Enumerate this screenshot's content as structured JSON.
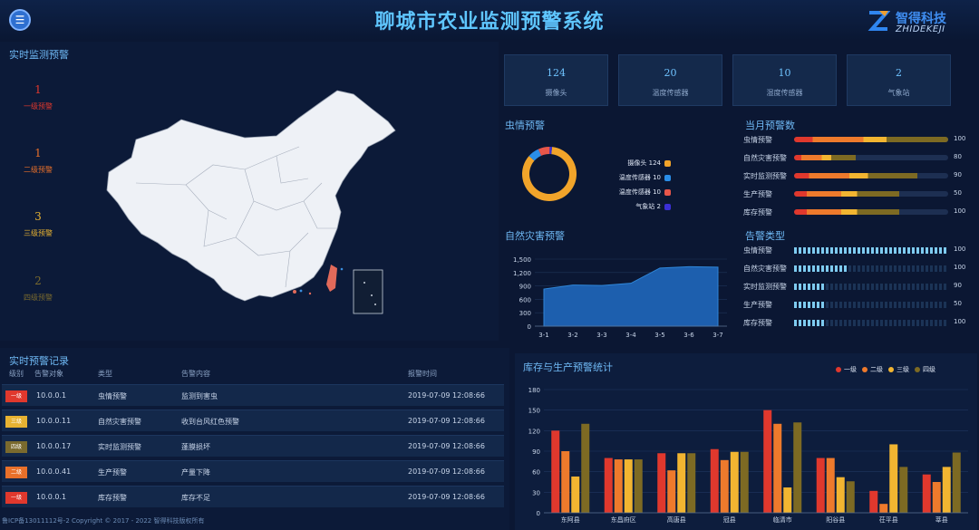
{
  "header": {
    "title": "聊城市农业监测预警系统",
    "logo_cn": "智得科技",
    "logo_en": "ZHIDEKEJI"
  },
  "realtime": {
    "title": "实时监测预警",
    "levels": [
      {
        "count": "1",
        "label": "一级预警",
        "color": "#e0382d"
      },
      {
        "count": "1",
        "label": "二级预警",
        "color": "#e8702a"
      },
      {
        "count": "3",
        "label": "三级预警",
        "color": "#e7b232"
      },
      {
        "count": "2",
        "label": "四级预警",
        "color": "#7a6a2e"
      }
    ]
  },
  "tiles": [
    {
      "value": "124",
      "label": "摄像头"
    },
    {
      "value": "20",
      "label": "温度传感器"
    },
    {
      "value": "10",
      "label": "湿度传感器"
    },
    {
      "value": "2",
      "label": "气象站"
    }
  ],
  "pest": {
    "title": "虫情预警",
    "legend": [
      {
        "label": "摄像头",
        "value": "124",
        "color": "#f1a42a"
      },
      {
        "label": "温度传感器",
        "value": "10",
        "color": "#2a8ee8"
      },
      {
        "label": "温度传感器",
        "value": "10",
        "color": "#e8564a"
      },
      {
        "label": "气象站",
        "value": "2",
        "color": "#3b2fd6"
      }
    ]
  },
  "monthly": {
    "title": "当月预警数",
    "rows": [
      {
        "label": "虫情预警",
        "value": "100",
        "fill": 1.0
      },
      {
        "label": "自然灾害预警",
        "value": "80",
        "fill": 0.4
      },
      {
        "label": "实时监测预警",
        "value": "90",
        "fill": 0.8
      },
      {
        "label": "生产预警",
        "value": "50",
        "fill": 0.68
      },
      {
        "label": "库存预警",
        "value": "100",
        "fill": 0.68
      }
    ]
  },
  "alarm_types": {
    "title": "告警类型",
    "rows": [
      {
        "label": "虫情预警",
        "value": "100",
        "fill": 1.0
      },
      {
        "label": "自然灾害预警",
        "value": "100",
        "fill": 0.35
      },
      {
        "label": "实时监测预警",
        "value": "90",
        "fill": 0.2
      },
      {
        "label": "生产预警",
        "value": "50",
        "fill": 0.2
      },
      {
        "label": "库存预警",
        "value": "100",
        "fill": 0.2
      }
    ]
  },
  "disaster": {
    "title": "自然灾害预警"
  },
  "records": {
    "title": "实时预警记录",
    "headers": [
      "级别",
      "告警对象",
      "类型",
      "告警内容",
      "报警时间"
    ],
    "rows": [
      {
        "level": "一级",
        "color": "#e0382d",
        "object": "10.0.0.1",
        "type": "虫情预警",
        "content": "监测到害虫",
        "time": "2019-07-09 12:08:66"
      },
      {
        "level": "三级",
        "color": "#e7b232",
        "object": "10.0.0.11",
        "type": "自然灾害预警",
        "content": "收到台风红色预警",
        "time": "2019-07-09 12:08:66"
      },
      {
        "level": "四级",
        "color": "#7a6a2e",
        "object": "10.0.0.17",
        "type": "实时监测预警",
        "content": "蓬膜损坏",
        "time": "2019-07-09 12:08:66"
      },
      {
        "level": "二级",
        "color": "#e8702a",
        "object": "10.0.0.41",
        "type": "生产预警",
        "content": "产量下降",
        "time": "2019-07-09 12:08:66"
      },
      {
        "level": "一级",
        "color": "#e0382d",
        "object": "10.0.0.1",
        "type": "库存预警",
        "content": "库存不足",
        "time": "2019-07-09 12:08:66"
      }
    ]
  },
  "footer": {
    "text": "鲁ICP备13011112号-2   Copyright © 2017 - 2022  智得科技版权所有"
  },
  "stock": {
    "title": "库存与生产预警统计"
  },
  "chart_data": [
    {
      "type": "area",
      "title": "自然灾害预警",
      "categories": [
        "3-1",
        "3-2",
        "3-3",
        "3-4",
        "3-5",
        "3-6",
        "3-7"
      ],
      "values": [
        830,
        920,
        910,
        960,
        1300,
        1330,
        1320
      ],
      "ylim": [
        0,
        1500
      ],
      "yticks": [
        "0",
        "300",
        "600",
        "900",
        "1,200",
        "1,500"
      ],
      "color": "#1f6fc4"
    },
    {
      "type": "bar",
      "title": "库存与生产预警统计",
      "categories": [
        "东阿县",
        "东昌府区",
        "高唐县",
        "冠县",
        "临清市",
        "阳谷县",
        "茌平县",
        "莘县"
      ],
      "ylim": [
        0,
        180
      ],
      "yticks": [
        "0",
        "30",
        "60",
        "90",
        "120",
        "150",
        "180"
      ],
      "series": [
        {
          "name": "一级",
          "color": "#e0382d",
          "values": [
            120,
            80,
            87,
            93,
            150,
            80,
            32,
            56
          ]
        },
        {
          "name": "二级",
          "color": "#ee7a2c",
          "values": [
            90,
            78,
            62,
            77,
            130,
            80,
            13,
            45
          ]
        },
        {
          "name": "三级",
          "color": "#f2b531",
          "values": [
            53,
            78,
            87,
            89,
            37,
            52,
            100,
            67
          ]
        },
        {
          "name": "四级",
          "color": "#7d6a23",
          "values": [
            130,
            78,
            87,
            89,
            132,
            46,
            67,
            88
          ]
        }
      ]
    },
    {
      "type": "pie",
      "title": "虫情预警",
      "categories": [
        "摄像头",
        "温度传感器",
        "温度传感器",
        "气象站"
      ],
      "values": [
        124,
        10,
        10,
        2
      ],
      "colors": [
        "#f1a42a",
        "#2a8ee8",
        "#e8564a",
        "#3b2fd6"
      ]
    }
  ]
}
